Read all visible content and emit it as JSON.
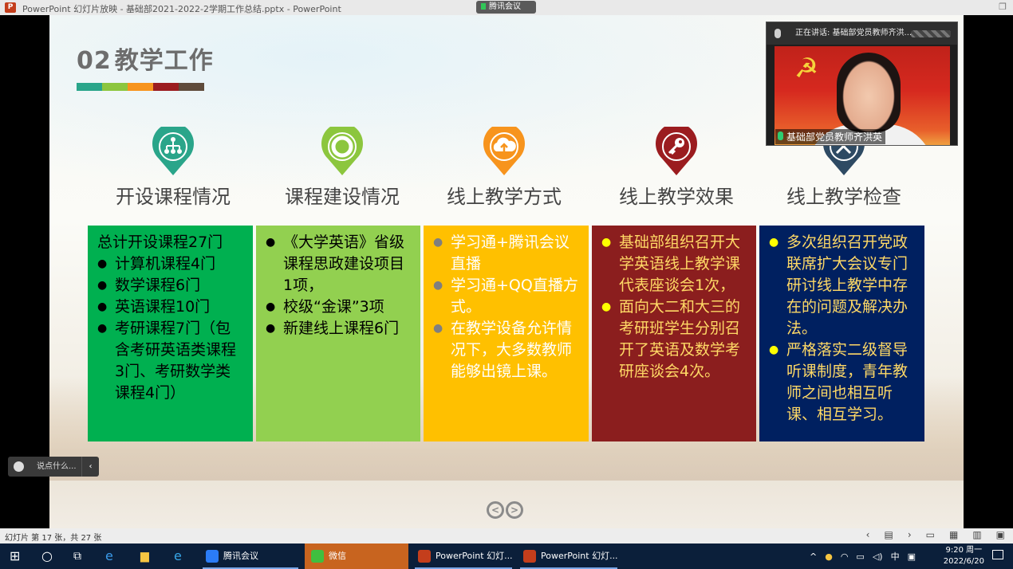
{
  "window": {
    "app_title": "PowerPoint 幻灯片放映 - 基础部2021-2022-2学期工作总结.pptx - PowerPoint",
    "meeting_tag": "腾讯会议"
  },
  "slide": {
    "number": "02",
    "heading": "教学工作",
    "colorbar": [
      "#2aa58a",
      "#8cc63e",
      "#f7941d",
      "#9b1c1f",
      "#5f4b3b"
    ],
    "columns": [
      {
        "title": "开设课程情况",
        "icon": "org-chart-icon",
        "icon_color": "#2aa58a",
        "card_color": "#00b050",
        "text_color": "#000000",
        "intro": "总计开设课程27门",
        "items": [
          "计算机课程4门",
          "数学课程6门",
          "英语课程10门",
          "考研课程7门（包含考研英语类课程3门、考研数学类课程4门）"
        ]
      },
      {
        "title": "课程建设情况",
        "icon": "lifebuoy-icon",
        "icon_color": "#8cc63e",
        "card_color": "#92d050",
        "text_color": "#000000",
        "intro": "",
        "items": [
          "《大学英语》省级课程思政建设项目1项，",
          "校级“金课”3项",
          "新建线上课程6门"
        ]
      },
      {
        "title": "线上教学方式",
        "icon": "cloud-upload-icon",
        "icon_color": "#f7941d",
        "card_color": "#ffc000",
        "text_color": "#ffffff",
        "bullet_color": "#7f7f7f",
        "intro": "",
        "items": [
          "学习通+腾讯会议直播",
          "学习通+QQ直播方式。",
          "在教学设备允许情况下，大多数教师能够出镜上课。"
        ]
      },
      {
        "title": "线上教学效果",
        "icon": "key-icon",
        "icon_color": "#9b1c1f",
        "card_color": "#8b1e1e",
        "text_color": "#ffd966",
        "bullet_color": "#ffff00",
        "intro": "",
        "items": [
          "基础部组织召开大学英语线上教学课代表座谈会1次，",
          "面向大二和大三的考研班学生分别召开了英语及数学考研座谈会4次。"
        ]
      },
      {
        "title": "线上教学检查",
        "icon": "tools-icon",
        "icon_color": "#2e4a63",
        "card_color": "#002060",
        "text_color": "#ffd966",
        "bullet_color": "#ffff00",
        "intro": "",
        "items": [
          "多次组织召开党政联席扩大会议专门研讨线上教学中存在的问题及解决办法。",
          "严格落实二级督导听课制度，青年教师之间也相互听课、相互学习。"
        ]
      }
    ]
  },
  "video": {
    "speaking_label": "正在讲话: 基础部党员教师齐洪...",
    "participant_name": "基础部党员教师齐洪英"
  },
  "chat": {
    "placeholder": "说点什么..."
  },
  "statusbar": {
    "slide_info": "幻灯片 第 17 张，共 27 张"
  },
  "taskbar": {
    "apps": [
      {
        "label": "腾讯会议",
        "icon": "tencent-meeting-icon",
        "color": "#2b7cf6"
      },
      {
        "label": "微信",
        "icon": "wechat-icon",
        "color": "#3fbf3f"
      },
      {
        "label": "PowerPoint 幻灯...",
        "icon": "powerpoint-icon",
        "color": "#c43e1c"
      },
      {
        "label": "PowerPoint 幻灯...",
        "icon": "powerpoint-icon",
        "color": "#c43e1c"
      }
    ],
    "ime": "中",
    "time": "9:20 周一",
    "date": "2022/6/20"
  }
}
